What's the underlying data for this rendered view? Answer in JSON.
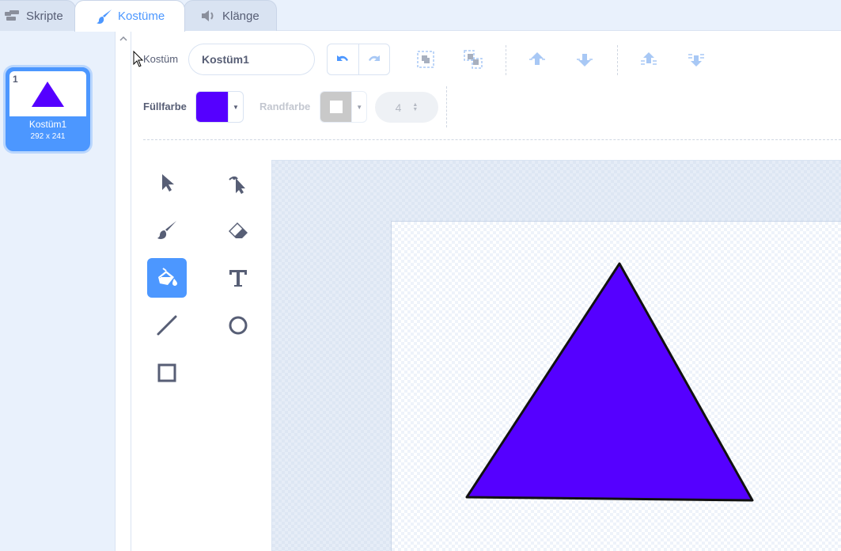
{
  "tabs": [
    {
      "label": "Skripte",
      "icon": "code-icon"
    },
    {
      "label": "Kostüme",
      "icon": "paintbrush-icon",
      "active": true
    },
    {
      "label": "Klänge",
      "icon": "speaker-icon"
    }
  ],
  "costumes": [
    {
      "number": "1",
      "name": "Kostüm1",
      "size": "292 x 241"
    }
  ],
  "toolbar": {
    "costume_label": "Kostüm",
    "costume_name": "Kostüm1",
    "fill_label": "Füllfarbe",
    "fill_color": "#5500ff",
    "outline_label": "Randfarbe",
    "outline_color": "#a6a6a6",
    "stroke_width": "4"
  },
  "tools": [
    {
      "name": "select",
      "icon": "select-arrow-icon"
    },
    {
      "name": "reshape",
      "icon": "reshape-icon"
    },
    {
      "name": "brush",
      "icon": "brush-icon"
    },
    {
      "name": "eraser",
      "icon": "eraser-icon"
    },
    {
      "name": "fill",
      "icon": "fill-bucket-icon",
      "active": true
    },
    {
      "name": "text",
      "icon": "text-icon"
    },
    {
      "name": "line",
      "icon": "line-icon"
    },
    {
      "name": "circle",
      "icon": "circle-icon"
    },
    {
      "name": "rectangle",
      "icon": "rectangle-icon"
    }
  ],
  "colors": {
    "accent": "#4c97ff",
    "text": "#575e75",
    "triangle_fill": "#5500ff",
    "triangle_stroke": "#111111"
  }
}
